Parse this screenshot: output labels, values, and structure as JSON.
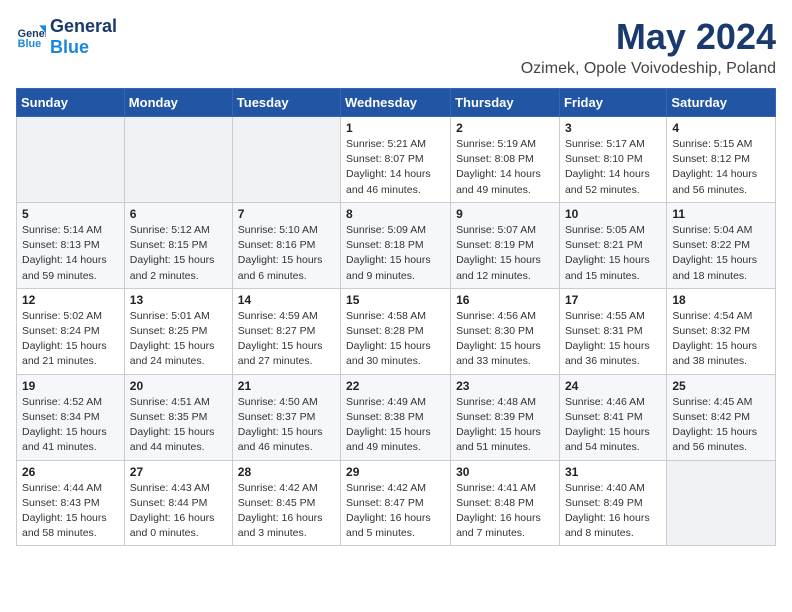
{
  "header": {
    "logo_general": "General",
    "logo_blue": "Blue",
    "month_title": "May 2024",
    "location": "Ozimek, Opole Voivodeship, Poland"
  },
  "weekdays": [
    "Sunday",
    "Monday",
    "Tuesday",
    "Wednesday",
    "Thursday",
    "Friday",
    "Saturday"
  ],
  "weeks": [
    [
      {
        "day": "",
        "info": ""
      },
      {
        "day": "",
        "info": ""
      },
      {
        "day": "",
        "info": ""
      },
      {
        "day": "1",
        "info": "Sunrise: 5:21 AM\nSunset: 8:07 PM\nDaylight: 14 hours\nand 46 minutes."
      },
      {
        "day": "2",
        "info": "Sunrise: 5:19 AM\nSunset: 8:08 PM\nDaylight: 14 hours\nand 49 minutes."
      },
      {
        "day": "3",
        "info": "Sunrise: 5:17 AM\nSunset: 8:10 PM\nDaylight: 14 hours\nand 52 minutes."
      },
      {
        "day": "4",
        "info": "Sunrise: 5:15 AM\nSunset: 8:12 PM\nDaylight: 14 hours\nand 56 minutes."
      }
    ],
    [
      {
        "day": "5",
        "info": "Sunrise: 5:14 AM\nSunset: 8:13 PM\nDaylight: 14 hours\nand 59 minutes."
      },
      {
        "day": "6",
        "info": "Sunrise: 5:12 AM\nSunset: 8:15 PM\nDaylight: 15 hours\nand 2 minutes."
      },
      {
        "day": "7",
        "info": "Sunrise: 5:10 AM\nSunset: 8:16 PM\nDaylight: 15 hours\nand 6 minutes."
      },
      {
        "day": "8",
        "info": "Sunrise: 5:09 AM\nSunset: 8:18 PM\nDaylight: 15 hours\nand 9 minutes."
      },
      {
        "day": "9",
        "info": "Sunrise: 5:07 AM\nSunset: 8:19 PM\nDaylight: 15 hours\nand 12 minutes."
      },
      {
        "day": "10",
        "info": "Sunrise: 5:05 AM\nSunset: 8:21 PM\nDaylight: 15 hours\nand 15 minutes."
      },
      {
        "day": "11",
        "info": "Sunrise: 5:04 AM\nSunset: 8:22 PM\nDaylight: 15 hours\nand 18 minutes."
      }
    ],
    [
      {
        "day": "12",
        "info": "Sunrise: 5:02 AM\nSunset: 8:24 PM\nDaylight: 15 hours\nand 21 minutes."
      },
      {
        "day": "13",
        "info": "Sunrise: 5:01 AM\nSunset: 8:25 PM\nDaylight: 15 hours\nand 24 minutes."
      },
      {
        "day": "14",
        "info": "Sunrise: 4:59 AM\nSunset: 8:27 PM\nDaylight: 15 hours\nand 27 minutes."
      },
      {
        "day": "15",
        "info": "Sunrise: 4:58 AM\nSunset: 8:28 PM\nDaylight: 15 hours\nand 30 minutes."
      },
      {
        "day": "16",
        "info": "Sunrise: 4:56 AM\nSunset: 8:30 PM\nDaylight: 15 hours\nand 33 minutes."
      },
      {
        "day": "17",
        "info": "Sunrise: 4:55 AM\nSunset: 8:31 PM\nDaylight: 15 hours\nand 36 minutes."
      },
      {
        "day": "18",
        "info": "Sunrise: 4:54 AM\nSunset: 8:32 PM\nDaylight: 15 hours\nand 38 minutes."
      }
    ],
    [
      {
        "day": "19",
        "info": "Sunrise: 4:52 AM\nSunset: 8:34 PM\nDaylight: 15 hours\nand 41 minutes."
      },
      {
        "day": "20",
        "info": "Sunrise: 4:51 AM\nSunset: 8:35 PM\nDaylight: 15 hours\nand 44 minutes."
      },
      {
        "day": "21",
        "info": "Sunrise: 4:50 AM\nSunset: 8:37 PM\nDaylight: 15 hours\nand 46 minutes."
      },
      {
        "day": "22",
        "info": "Sunrise: 4:49 AM\nSunset: 8:38 PM\nDaylight: 15 hours\nand 49 minutes."
      },
      {
        "day": "23",
        "info": "Sunrise: 4:48 AM\nSunset: 8:39 PM\nDaylight: 15 hours\nand 51 minutes."
      },
      {
        "day": "24",
        "info": "Sunrise: 4:46 AM\nSunset: 8:41 PM\nDaylight: 15 hours\nand 54 minutes."
      },
      {
        "day": "25",
        "info": "Sunrise: 4:45 AM\nSunset: 8:42 PM\nDaylight: 15 hours\nand 56 minutes."
      }
    ],
    [
      {
        "day": "26",
        "info": "Sunrise: 4:44 AM\nSunset: 8:43 PM\nDaylight: 15 hours\nand 58 minutes."
      },
      {
        "day": "27",
        "info": "Sunrise: 4:43 AM\nSunset: 8:44 PM\nDaylight: 16 hours\nand 0 minutes."
      },
      {
        "day": "28",
        "info": "Sunrise: 4:42 AM\nSunset: 8:45 PM\nDaylight: 16 hours\nand 3 minutes."
      },
      {
        "day": "29",
        "info": "Sunrise: 4:42 AM\nSunset: 8:47 PM\nDaylight: 16 hours\nand 5 minutes."
      },
      {
        "day": "30",
        "info": "Sunrise: 4:41 AM\nSunset: 8:48 PM\nDaylight: 16 hours\nand 7 minutes."
      },
      {
        "day": "31",
        "info": "Sunrise: 4:40 AM\nSunset: 8:49 PM\nDaylight: 16 hours\nand 8 minutes."
      },
      {
        "day": "",
        "info": ""
      }
    ]
  ]
}
